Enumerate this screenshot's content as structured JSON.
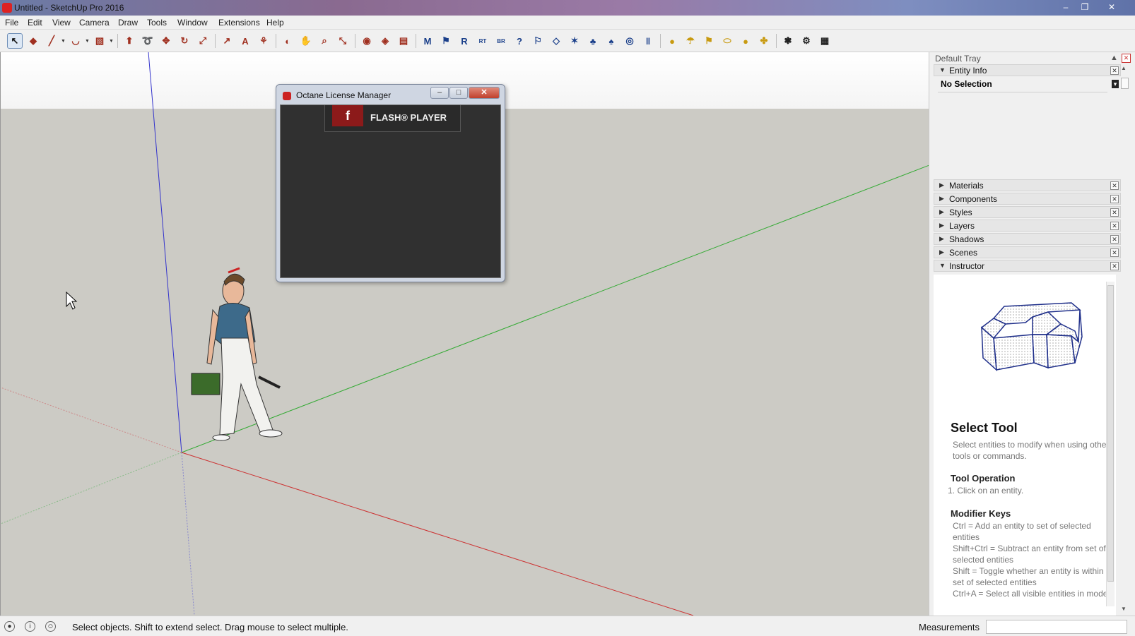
{
  "window": {
    "title": "Untitled - SketchUp Pro 2016",
    "minimize": "–",
    "restore": "❐",
    "close": "✕"
  },
  "menu": [
    "File",
    "Edit",
    "View",
    "Camera",
    "Draw",
    "Tools",
    "Window",
    "Extensions",
    "Help"
  ],
  "toolbar": {
    "tools": [
      {
        "name": "select-tool-icon",
        "glyph": "↖"
      },
      {
        "name": "eraser-tool-icon",
        "glyph": "◆"
      },
      {
        "name": "pencil-tool-icon",
        "glyph": "╱"
      },
      {
        "name": "arc-tool-icon",
        "glyph": "◡"
      },
      {
        "name": "rectangle-tool-icon",
        "glyph": "▧"
      },
      {
        "name": "push-pull-tool-icon",
        "glyph": "⬆"
      },
      {
        "name": "follow-me-tool-icon",
        "glyph": "➰"
      },
      {
        "name": "move-tool-icon",
        "glyph": "✥"
      },
      {
        "name": "rotate-tool-icon",
        "glyph": "↻"
      },
      {
        "name": "scale-tool-icon",
        "glyph": "⤢"
      },
      {
        "name": "tape-measure-icon",
        "glyph": "↗"
      },
      {
        "name": "text-tool-icon",
        "glyph": "A"
      },
      {
        "name": "paint-bucket-icon",
        "glyph": "⚘"
      },
      {
        "name": "orbit-tool-icon",
        "glyph": "◐"
      },
      {
        "name": "pan-tool-icon",
        "glyph": "✋"
      },
      {
        "name": "zoom-tool-icon",
        "glyph": "⌕"
      },
      {
        "name": "zoom-extents-icon",
        "glyph": "⤡"
      },
      {
        "name": "warehouse-icon",
        "glyph": "◉"
      },
      {
        "name": "share-model-icon",
        "glyph": "◈"
      },
      {
        "name": "extension-warehouse-icon",
        "glyph": "▤"
      },
      {
        "name": "octane-m-icon",
        "glyph": "M"
      },
      {
        "name": "octane-tag-icon",
        "glyph": "⚑"
      },
      {
        "name": "octane-r-icon",
        "glyph": "R"
      },
      {
        "name": "octane-rt-icon",
        "glyph": "RT"
      },
      {
        "name": "octane-br-icon",
        "glyph": "BR"
      },
      {
        "name": "octane-help-icon",
        "glyph": "?"
      },
      {
        "name": "octane-label-icon",
        "glyph": "⚐"
      },
      {
        "name": "octane-diamond-icon",
        "glyph": "◇"
      },
      {
        "name": "octane-sun-icon",
        "glyph": "✶"
      },
      {
        "name": "octane-tree-icon",
        "glyph": "♣"
      },
      {
        "name": "octane-tree2-icon",
        "glyph": "♠"
      },
      {
        "name": "octane-target-icon",
        "glyph": "◎"
      },
      {
        "name": "octane-pause-icon",
        "glyph": "‖"
      },
      {
        "name": "light-sphere-icon",
        "glyph": "●"
      },
      {
        "name": "light-spot-icon",
        "glyph": "☂"
      },
      {
        "name": "light-flag-icon",
        "glyph": "⚑"
      },
      {
        "name": "light-oval-icon",
        "glyph": "⬭"
      },
      {
        "name": "light-dot-icon",
        "glyph": "●"
      },
      {
        "name": "light-pin-icon",
        "glyph": "✤"
      },
      {
        "name": "fan-icon",
        "glyph": "❃"
      },
      {
        "name": "gear-icon",
        "glyph": "⚙"
      },
      {
        "name": "calculator-icon",
        "glyph": "▦"
      }
    ]
  },
  "dialog": {
    "title": "Octane License Manager",
    "flash_label": "FLASH® PLAYER",
    "flash_logo": "f"
  },
  "tray": {
    "title": "Default Tray",
    "entity_info": "Entity Info",
    "no_selection": "No Selection",
    "panels": [
      "Materials",
      "Components",
      "Styles",
      "Layers",
      "Shadows",
      "Scenes"
    ],
    "instructor": "Instructor",
    "instructor_content": {
      "heading": "Select Tool",
      "intro": "Select entities to modify when using other tools or commands.",
      "op_heading": "Tool Operation",
      "op_step": "1.   Click on an entity.",
      "mod_heading": "Modifier Keys",
      "mod_ctrl": "Ctrl = Add an entity to set of selected entities",
      "mod_shift_ctrl": "Shift+Ctrl = Subtract an entity from set of selected entities",
      "mod_shift": "Shift = Toggle whether an entity is within set of selected entities",
      "mod_ctrl_a": "Ctrl+A = Select all visible entities in model"
    }
  },
  "status": {
    "text": "Select objects. Shift to extend select. Drag mouse to select multiple.",
    "measurements": "Measurements"
  },
  "colors": {
    "ground": "#cccbc5",
    "axis_red": "#cc3333",
    "axis_green": "#33aa33",
    "axis_blue": "#3333cc"
  }
}
